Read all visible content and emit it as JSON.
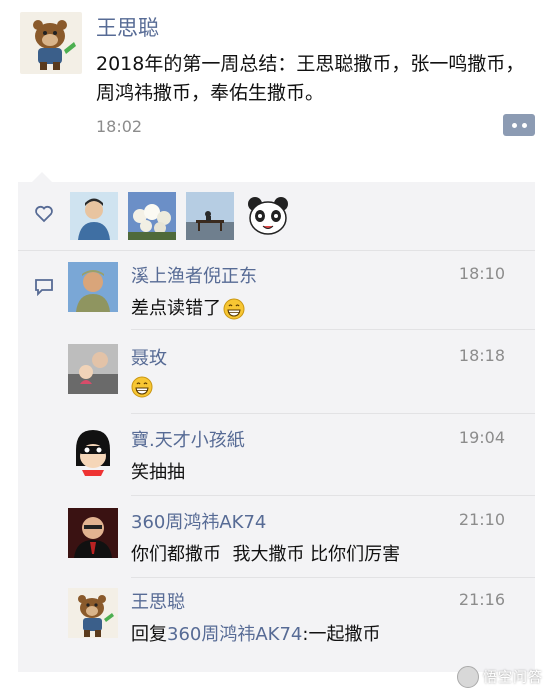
{
  "post": {
    "author": "王思聪",
    "text": "2018年的第一周总结：王思聪撒币，张一鸣撒币，周鸿祎撒币，奉佑生撒币。",
    "time": "18:02",
    "avatar_icon": "bear-cartoon-avatar"
  },
  "likes": {
    "icon": "heart-icon",
    "avatars": [
      "man-portrait-avatar",
      "flowers-photo-avatar",
      "seaside-bench-avatar",
      "panda-cartoon-avatar"
    ]
  },
  "comments": [
    {
      "name": "溪上渔者倪正东",
      "time": "18:10",
      "text": "差点读错了",
      "emoji": "grin-emoji",
      "avatar": "old-man-avatar"
    },
    {
      "name": "聂玫",
      "time": "18:18",
      "text": "",
      "emoji": "grin-emoji",
      "avatar": "family-photo-avatar"
    },
    {
      "name": "寶.天才小孩紙",
      "time": "19:04",
      "text": "笑抽抽",
      "emoji": "",
      "avatar": "masked-kid-cartoon-avatar"
    },
    {
      "name": "360周鸿祎AK74",
      "time": "21:10",
      "text": "你们都撒币  我大撒币 比你们厉害",
      "emoji": "",
      "avatar": "man-red-background-avatar"
    },
    {
      "name": "王思聪",
      "time": "21:16",
      "reply_prefix": "回复",
      "reply_to": "360周鸿祎AK74",
      "reply_text": ":一起撒币",
      "avatar": "bear-cartoon-avatar"
    }
  ],
  "watermark": "悟空问答"
}
